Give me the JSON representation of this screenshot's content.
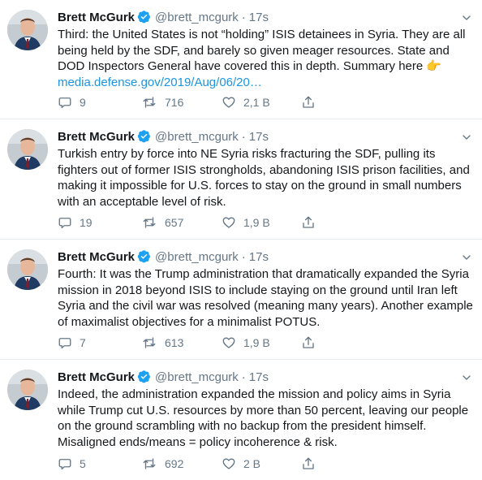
{
  "colors": {
    "text": "#14171a",
    "secondary": "#657786",
    "link": "#1b95e0",
    "verified": "#1da1f2",
    "divider": "#e6ecf0"
  },
  "tweets": [
    {
      "author": "Brett McGurk",
      "handle": "@brett_mcgurk",
      "separator": "·",
      "time": "17s",
      "text": "Third: the United States is not “holding” ISIS detainees in Syria. They are all being held by the SDF, and barely so given meager resources. State and DOD Inspectors General have covered this in depth. Summary here ",
      "emoji": "👉",
      "link": "media.defense.gov/2019/Aug/06/20…",
      "replies": "9",
      "retweets": "716",
      "likes": "2,1 B"
    },
    {
      "author": "Brett McGurk",
      "handle": "@brett_mcgurk",
      "separator": "·",
      "time": "17s",
      "text": "Turkish entry by force into NE Syria risks fracturing the SDF, pulling its fighters out of former ISIS strongholds, abandoning ISIS prison facilities, and making it impossible for U.S. forces to stay on the ground in small numbers with an acceptable level of risk.",
      "replies": "19",
      "retweets": "657",
      "likes": "1,9 B"
    },
    {
      "author": "Brett McGurk",
      "handle": "@brett_mcgurk",
      "separator": "·",
      "time": "17s",
      "text": "Fourth: It was the Trump administration that dramatically expanded the Syria mission in 2018 beyond ISIS to include staying on the ground until Iran left Syria and the civil war was resolved (meaning many years). Another example of maximalist objectives for a minimalist POTUS.",
      "replies": "7",
      "retweets": "613",
      "likes": "1,9 B"
    },
    {
      "author": "Brett McGurk",
      "handle": "@brett_mcgurk",
      "separator": "·",
      "time": "17s",
      "text": "Indeed, the administration expanded the mission and policy aims in Syria while Trump cut U.S. resources by more than 50 percent, leaving our people on the ground scrambling with no backup from the president himself. Misaligned ends/means = policy incoherence & risk.",
      "replies": "5",
      "retweets": "692",
      "likes": "2 B"
    }
  ],
  "icons": {
    "verified": "verified-badge-icon",
    "caret": "chevron-down-icon",
    "reply": "reply-icon",
    "retweet": "retweet-icon",
    "like": "heart-icon",
    "share": "share-icon"
  }
}
